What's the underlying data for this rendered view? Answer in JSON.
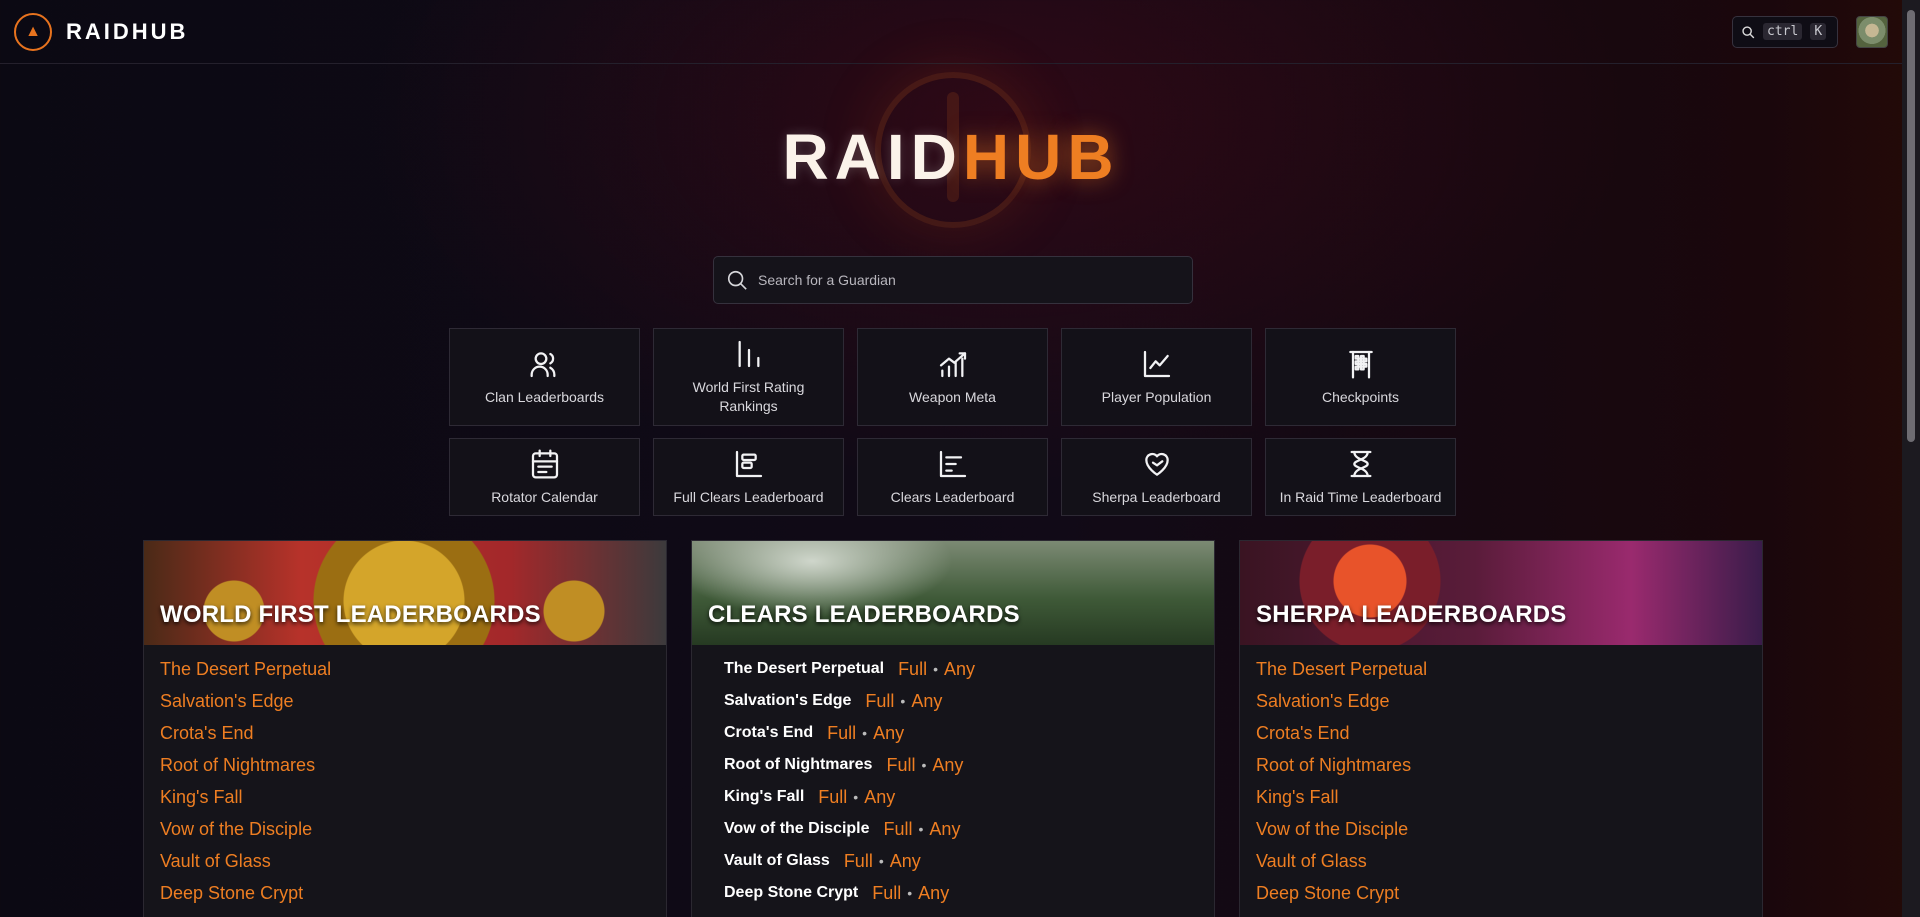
{
  "header": {
    "brand": "RAIDHUB",
    "shortcut_ctrl": "ctrl",
    "shortcut_key": "K"
  },
  "hero": {
    "title_a": "RAID",
    "title_b": "HUB"
  },
  "search": {
    "placeholder": "Search for a Guardian"
  },
  "tiles": [
    {
      "label": "Clan Leaderboards",
      "icon": "users-icon"
    },
    {
      "label": "World First Rating Rankings",
      "icon": "bar-chart-icon"
    },
    {
      "label": "Weapon Meta",
      "icon": "trend-bars-icon"
    },
    {
      "label": "Player Population",
      "icon": "line-chart-icon"
    },
    {
      "label": "Checkpoints",
      "icon": "checkered-flag-icon"
    },
    {
      "label": "Rotator Calendar",
      "icon": "calendar-icon"
    },
    {
      "label": "Full Clears Leaderboard",
      "icon": "leaderboard-icon"
    },
    {
      "label": "Clears Leaderboard",
      "icon": "sorted-bars-icon"
    },
    {
      "label": "Sherpa Leaderboard",
      "icon": "handshake-heart-icon"
    },
    {
      "label": "In Raid Time Leaderboard",
      "icon": "hourglass-icon"
    }
  ],
  "cards": {
    "world_first": {
      "title": "WORLD FIRST LEADERBOARDS",
      "items": [
        "The Desert Perpetual",
        "Salvation's Edge",
        "Crota's End",
        "Root of Nightmares",
        "King's Fall",
        "Vow of the Disciple",
        "Vault of Glass",
        "Deep Stone Crypt"
      ]
    },
    "clears": {
      "title": "CLEARS LEADERBOARDS",
      "full": "Full",
      "any": "Any",
      "sep": "•",
      "items": [
        "The Desert Perpetual",
        "Salvation's Edge",
        "Crota's End",
        "Root of Nightmares",
        "King's Fall",
        "Vow of the Disciple",
        "Vault of Glass",
        "Deep Stone Crypt"
      ]
    },
    "sherpa": {
      "title": "SHERPA LEADERBOARDS",
      "items": [
        "The Desert Perpetual",
        "Salvation's Edge",
        "Crota's End",
        "Root of Nightmares",
        "King's Fall",
        "Vow of the Disciple",
        "Vault of Glass",
        "Deep Stone Crypt"
      ]
    }
  },
  "colors": {
    "accent": "#ee7e22",
    "background": "#0b0913",
    "tile": "#131118"
  }
}
